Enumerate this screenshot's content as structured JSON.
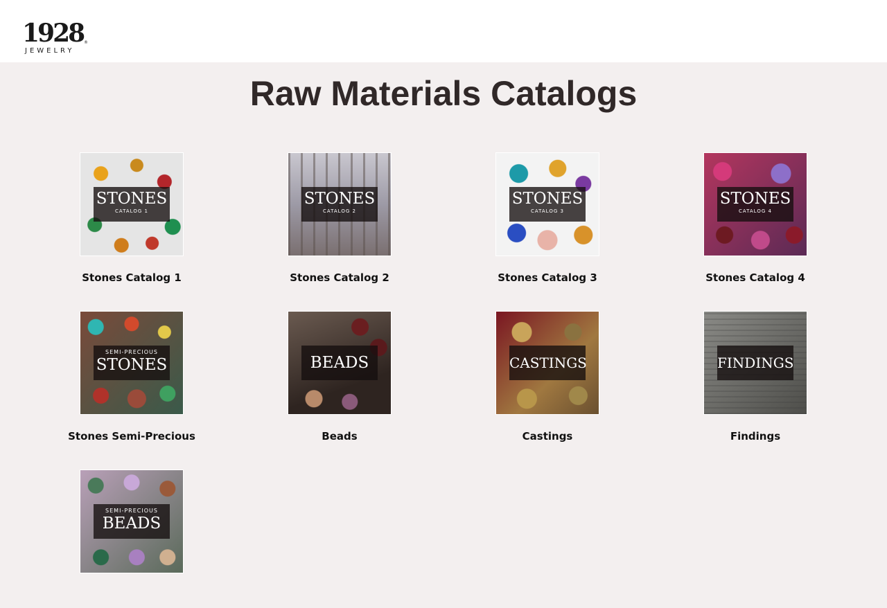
{
  "logo": {
    "number": "1928",
    "registered": "®",
    "subtitle": "JEWELRY"
  },
  "page": {
    "title": "Raw Materials Catalogs"
  },
  "catalogs": [
    {
      "label": "Stones Catalog 1",
      "badge_top": "",
      "badge_main": "STONES",
      "badge_bottom": "CATALOG 1"
    },
    {
      "label": "Stones Catalog 2",
      "badge_top": "",
      "badge_main": "STONES",
      "badge_bottom": "CATALOG 2"
    },
    {
      "label": "Stones Catalog 3",
      "badge_top": "",
      "badge_main": "STONES",
      "badge_bottom": "CATALOG 3"
    },
    {
      "label": "Stones Catalog 4",
      "badge_top": "",
      "badge_main": "STONES",
      "badge_bottom": "CATALOG 4"
    },
    {
      "label": "Stones Semi-Precious",
      "badge_top": "SEMI-PRECIOUS",
      "badge_main": "STONES",
      "badge_bottom": ""
    },
    {
      "label": "Beads",
      "badge_top": "",
      "badge_main": "BEADS",
      "badge_bottom": ""
    },
    {
      "label": "Castings",
      "badge_top": "",
      "badge_main": "CASTINGS",
      "badge_bottom": ""
    },
    {
      "label": "Findings",
      "badge_top": "",
      "badge_main": "FINDINGS",
      "badge_bottom": ""
    },
    {
      "label": "",
      "badge_top": "SEMI-PRECIOUS",
      "badge_main": "BEADS",
      "badge_bottom": ""
    }
  ]
}
